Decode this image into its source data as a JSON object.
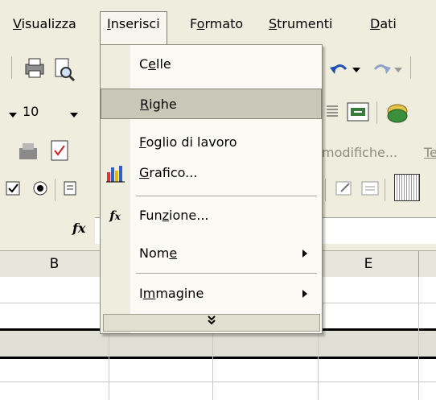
{
  "menubar": {
    "items": [
      {
        "label": "Visualizza",
        "accel": "V"
      },
      {
        "label": "Inserisci",
        "accel": "I"
      },
      {
        "label": "Formato",
        "accel": "o"
      },
      {
        "label": "Strumenti",
        "accel": "S"
      },
      {
        "label": "Dati",
        "accel": "D"
      }
    ]
  },
  "toolbar": {
    "font_size": "10",
    "track_changes_label": "modifiche...",
    "truncated_label": "Te"
  },
  "formula_bar": {
    "fx_label": "fx"
  },
  "sheet": {
    "column_headers": [
      "B",
      "E"
    ]
  },
  "insert_menu": {
    "items": [
      {
        "label": "Celle",
        "underline": "e",
        "has_submenu": false
      },
      {
        "label": "Righe",
        "underline": "R",
        "has_submenu": false,
        "highlighted": true
      },
      {
        "label": "Foglio di lavoro",
        "underline": "F",
        "has_submenu": false
      },
      {
        "label": "Grafico...",
        "underline": "G",
        "has_submenu": false,
        "icon": "chart-icon"
      },
      {
        "label": "Funzione...",
        "underline": "z",
        "has_submenu": false,
        "icon": "function-icon"
      },
      {
        "label": "Nome",
        "underline": "e",
        "has_submenu": true
      },
      {
        "label": "Immagine",
        "underline": "m",
        "has_submenu": true
      }
    ],
    "expand_glyph": "»"
  },
  "colors": {
    "highlight": "#c9c7b7",
    "menu_bg": "#fbfaf5",
    "toolbar_bg": "#efedde"
  }
}
